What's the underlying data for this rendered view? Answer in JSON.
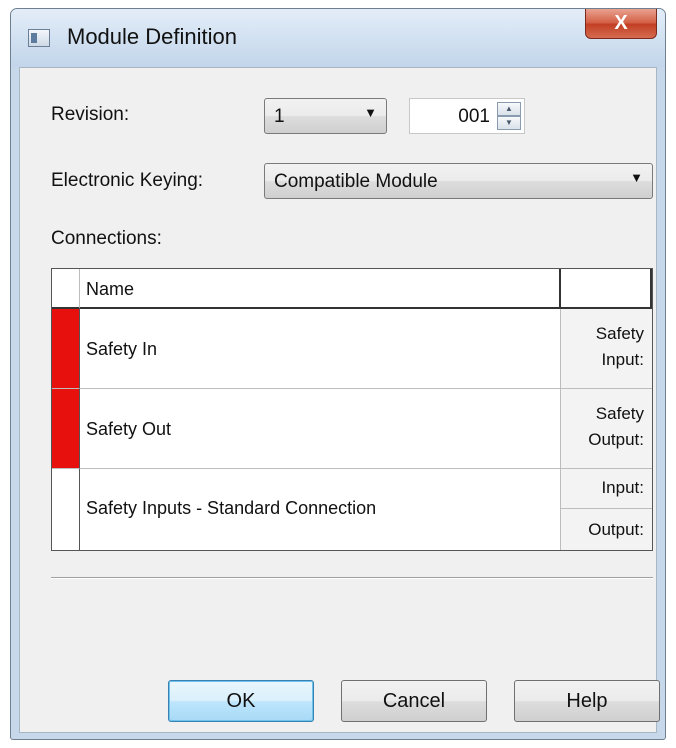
{
  "window": {
    "title": "Module Definition",
    "title_icon": "module-window-icon",
    "close_glyph": "X"
  },
  "revision": {
    "label": "Revision:",
    "major": "1",
    "minor": "001"
  },
  "keying": {
    "label": "Electronic Keying:",
    "value": "Compatible Module"
  },
  "connections": {
    "label": "Connections:",
    "columns": [
      "Name",
      ""
    ],
    "rows": [
      {
        "indicator_color": "#e8100c",
        "name": "Safety In",
        "types": [
          "Safety",
          "Input:"
        ]
      },
      {
        "indicator_color": "#e8100c",
        "name": "Safety Out",
        "types": [
          "Safety",
          "Output:"
        ]
      },
      {
        "indicator_color": "#ffffff",
        "name": "Safety Inputs - Standard Connection",
        "types": [
          "Input:",
          "Output:"
        ]
      }
    ]
  },
  "buttons": {
    "ok": "OK",
    "cancel": "Cancel",
    "help": "Help"
  },
  "colors": {
    "status_fault": "#e8100c",
    "close_button": "#c7432a",
    "default_button_border": "#3c7fb1"
  }
}
